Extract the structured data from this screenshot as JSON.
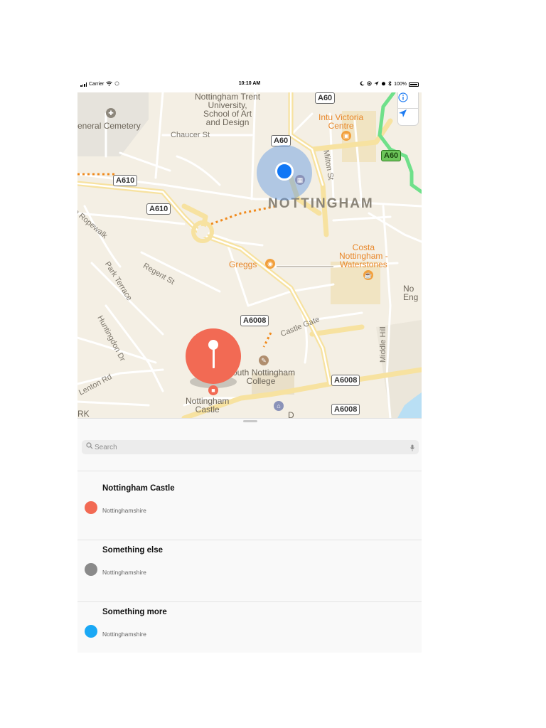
{
  "status_bar": {
    "carrier": "Carrier",
    "time": "10:10 AM",
    "battery": "100%"
  },
  "map": {
    "labels": {
      "cemetery": "eneral Cemetery",
      "university": "Nottingham Trent\nUniversity,\nSchool of Art\nand Design",
      "chaucer": "Chaucer St",
      "intu": "Intu Victoria\nCentre",
      "milton": "Milton St",
      "city": "NOTTINGHAM",
      "ropewalk": "e Ropewalk",
      "park_terrace": "Park Terrace",
      "regent": "Regent St",
      "greggs": "Greggs",
      "costa": "Costa\nNottingham -\nWaterstones",
      "no_eng": "No\nEng",
      "huntingdon": "Huntingdon Dr",
      "castle_gate": "Castle Gate",
      "middle_hill": "Middle Hill",
      "lenton": "Lenton Rd",
      "south_college": "South Nottingham\nCollege",
      "castle": "Nottingham\nCastle",
      "rk": "RK",
      "d": "D"
    },
    "shields": {
      "a60_top": "A60",
      "a60_mid": "A60",
      "a60_green": "A60",
      "a610_left": "A610",
      "a610_mid": "A610",
      "a6008_top": "A6008",
      "a6008_right": "A6008",
      "a6008_bottom": "A6008"
    }
  },
  "sheet": {
    "search_placeholder": "Search",
    "places": [
      {
        "title": "Nottingham Castle",
        "subtitle": "Nottinghamshire",
        "color": "#f26a54"
      },
      {
        "title": "Something else",
        "subtitle": "Nottinghamshire",
        "color": "#8a8a8a"
      },
      {
        "title": "Something more",
        "subtitle": "Nottinghamshire",
        "color": "#1aa8f5"
      }
    ]
  },
  "colors": {
    "accent": "#1e7cf2",
    "pin": "#f26a54",
    "user_location": "#1177f5",
    "map_background": "#f4efe4",
    "major_road": "#fbe8a6",
    "green_route": "#6fe08a",
    "footpath": "#f08a1c"
  }
}
